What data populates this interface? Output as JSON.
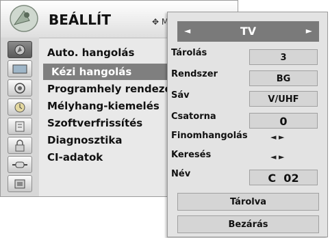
{
  "main_menu": {
    "title": "BEÁLLÍT",
    "move_hint": "M",
    "icons": [
      "antenna-icon",
      "picture-icon",
      "audio-icon",
      "time-icon",
      "option-icon",
      "lock-icon",
      "input-icon",
      "usb-icon"
    ],
    "items": [
      {
        "label": "Auto. hangolás"
      },
      {
        "label": "Kézi hangolás"
      },
      {
        "label": "Programhely rendezés"
      },
      {
        "label": "Mélyhang-kiemelés"
      },
      {
        "label": "Szoftverfrissítés"
      },
      {
        "label": "Diagnosztika"
      },
      {
        "label": "CI-adatok"
      }
    ],
    "selected_index": 1
  },
  "popup": {
    "source": "TV",
    "left_arrow": "◄",
    "right_arrow": "►",
    "rows": {
      "storage": {
        "label": "Tárolás",
        "value": "3"
      },
      "system": {
        "label": "Rendszer",
        "value": "BG"
      },
      "band": {
        "label": "Sáv",
        "value": "V/UHF"
      },
      "channel": {
        "label": "Csatorna",
        "value": "0"
      },
      "fine": {
        "label": "Finomhangolás",
        "value": "◄ ►"
      },
      "search": {
        "label": "Keresés",
        "value": "◄ ►"
      },
      "name": {
        "label": "Név",
        "value": "C  02"
      }
    },
    "stored_button": "Tárolva",
    "close_button": "Bezárás"
  },
  "colors": {
    "highlight": "#7f7f7f",
    "popup_bg": "#e3e3e3",
    "menu_bg": "#e9e9e9"
  }
}
